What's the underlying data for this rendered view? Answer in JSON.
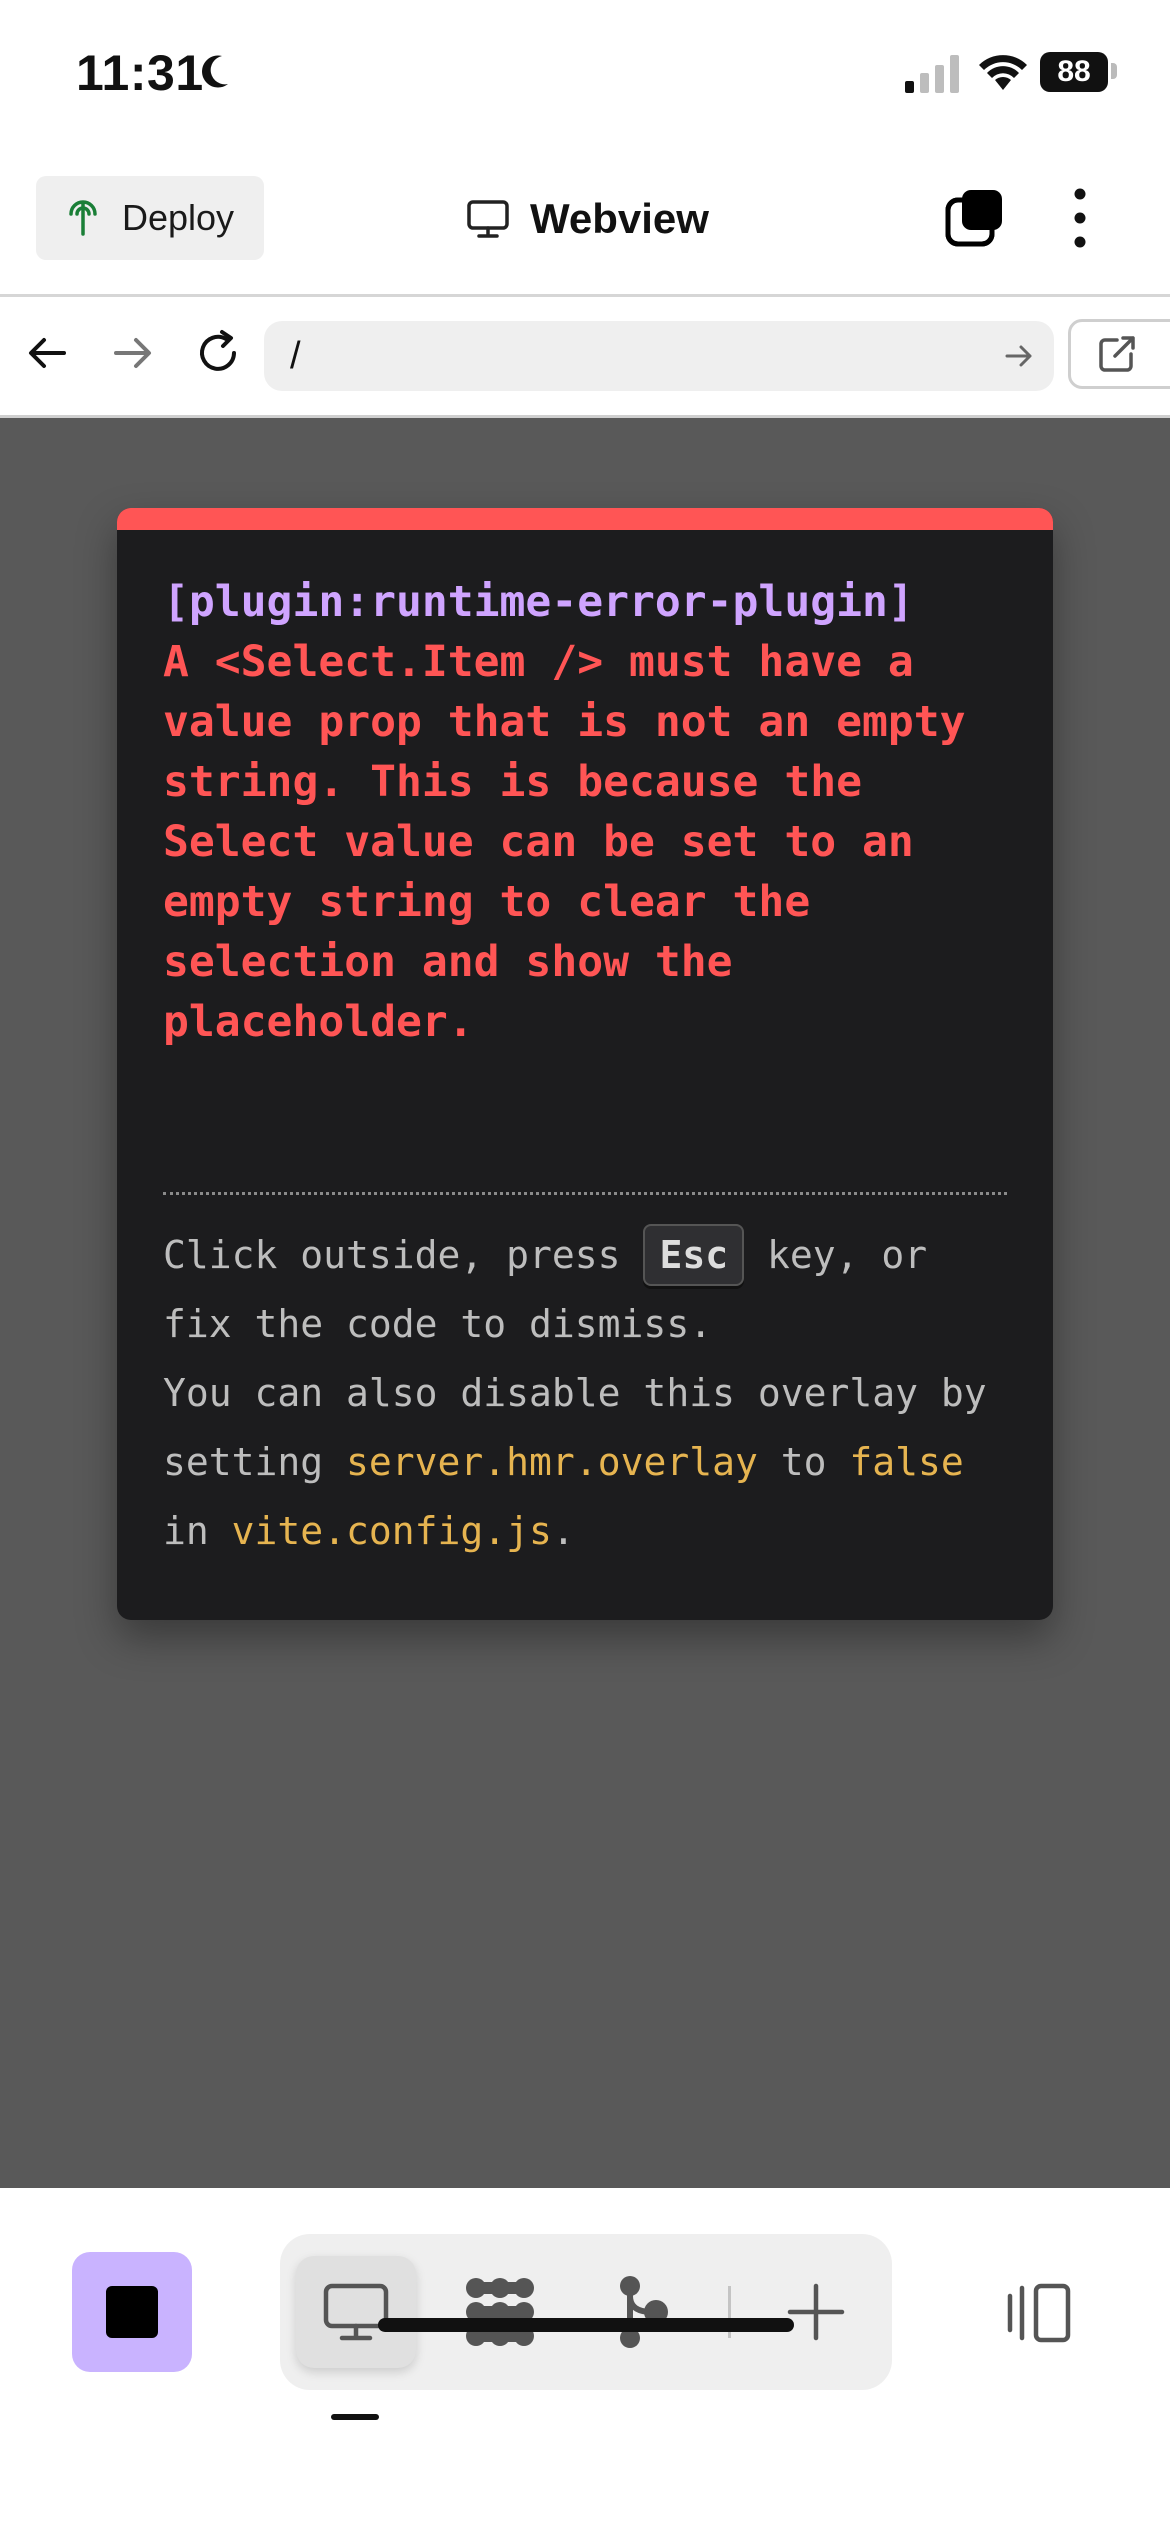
{
  "status_bar": {
    "time": "11:31",
    "battery": "88",
    "icons": [
      "moon-icon",
      "cellular-signal-icon",
      "wifi-icon",
      "battery-icon"
    ]
  },
  "header": {
    "deploy_label": "Deploy",
    "title": "Webview",
    "icons": [
      "deploy-tree-icon",
      "monitor-icon",
      "tabs-icon",
      "more-vertical-icon"
    ]
  },
  "url_bar": {
    "value": "/",
    "icons": [
      "back-arrow-icon",
      "forward-arrow-icon",
      "reload-icon",
      "go-arrow-icon",
      "open-external-icon"
    ]
  },
  "error_overlay": {
    "plugin": "[plugin:runtime-error-plugin]",
    "message": "A <Select.Item /> must have a value prop that is not an empty string. This is because the Select value can be set to an empty string to clear the selection and show the placeholder.",
    "tip": {
      "t1": "Click outside, press ",
      "key": "Esc",
      "t2": " key, or fix the code to dismiss.",
      "t3": "You can also disable this overlay by setting ",
      "code1": "server.hmr.overlay",
      "t4": " to ",
      "code2": "false",
      "t5": " in ",
      "code3": "vite.config.js",
      "t6": "."
    },
    "colors": {
      "accent": "#ff5555",
      "plugin": "#cfa4ff",
      "code": "#e6b450",
      "background": "#1c1c1e"
    }
  },
  "bottom_toolbar": {
    "icons": [
      "stop-icon",
      "webview-monitor-icon",
      "grid-blob-icon",
      "git-branch-icon",
      "plus-icon",
      "panel-layout-icon"
    ],
    "stop_color": "#c9b3ff"
  }
}
